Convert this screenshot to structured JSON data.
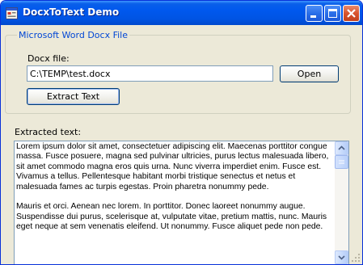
{
  "window": {
    "title": "DocxToText Demo",
    "icon": "app-form-icon",
    "controls": [
      "minimize-icon",
      "maximize-icon",
      "close-icon"
    ]
  },
  "group": {
    "legend": "Microsoft Word Docx File",
    "file_label": "Docx file:",
    "file_value": "C:\\TEMP\\test.docx",
    "open_label": "Open",
    "extract_label": "Extract Text"
  },
  "output": {
    "label": "Extracted text:",
    "paragraph_1": "Lorem ipsum dolor sit amet, consectetuer adipiscing elit. Maecenas porttitor congue massa. Fusce posuere, magna sed pulvinar ultricies, purus lectus malesuada libero, sit amet commodo magna eros quis urna. Nunc viverra imperdiet enim. Fusce est. Vivamus a tellus. Pellentesque habitant morbi tristique senectus et netus et malesuada fames ac turpis egestas. Proin pharetra nonummy pede.",
    "paragraph_2": "Mauris et orci. Aenean nec lorem. In porttitor. Donec laoreet nonummy augue. Suspendisse dui purus, scelerisque at, vulputate vitae, pretium mattis, nunc. Mauris eget neque at sem venenatis eleifend. Ut nonummy. Fusce aliquet pede non pede."
  },
  "colors": {
    "titlebar": "#0054e3",
    "window_face": "#ece9d8",
    "group_legend": "#0046d5",
    "close_button": "#d8542d"
  }
}
